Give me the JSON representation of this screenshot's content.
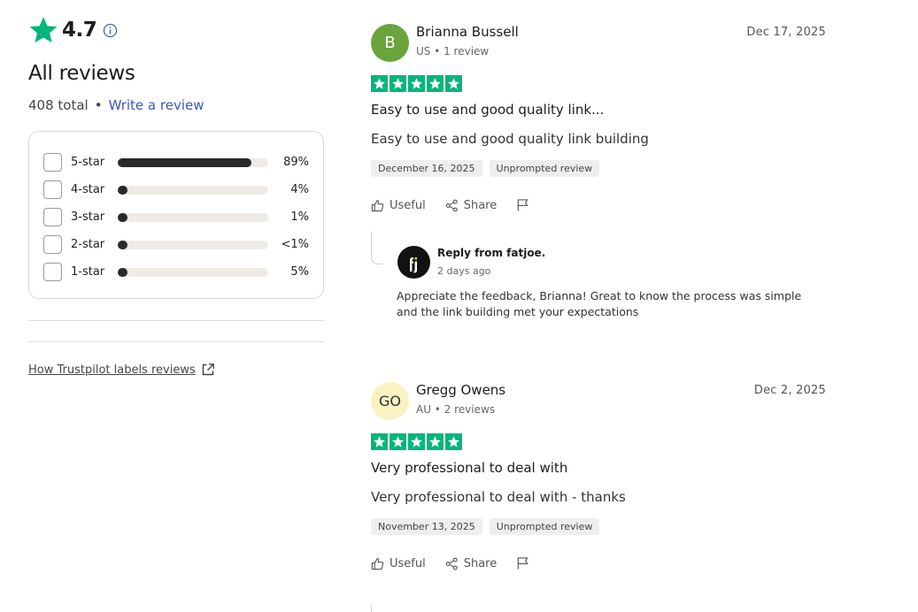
{
  "summary": {
    "rating": "4.7",
    "heading": "All reviews",
    "total": "408 total",
    "separator": "•",
    "write_review": "Write a review",
    "distribution": [
      {
        "label": "5-star",
        "percent_text": "89%",
        "fill": 0.89
      },
      {
        "label": "4-star",
        "percent_text": "4%",
        "fill": 0.04
      },
      {
        "label": "3-star",
        "percent_text": "1%",
        "fill": 0.01
      },
      {
        "label": "2-star",
        "percent_text": "<1%",
        "fill": 0.005
      },
      {
        "label": "1-star",
        "percent_text": "5%",
        "fill": 0.05
      }
    ],
    "labels_link": "How Trustpilot labels reviews"
  },
  "reviews": [
    {
      "avatar": "B",
      "name": "Brianna Bussell",
      "sub": "US • 1 review",
      "date": "Dec 17, 2025",
      "stars": 5,
      "title": "Easy to use and good quality link...",
      "body": "Easy to use and good quality link building",
      "tags": [
        "December 16, 2025",
        "Unprompted review"
      ],
      "useful": "Useful",
      "share": "Share",
      "reply": {
        "from": "Reply from fatjoe.",
        "time": "2 days ago",
        "text": "Appreciate the feedback, Brianna! Great to know the process was simple and the link building met your expectations"
      }
    },
    {
      "avatar": "GO",
      "name": "Gregg Owens",
      "sub": "AU • 2 reviews",
      "date": "Dec 2, 2025",
      "stars": 5,
      "title": "Very professional to deal with",
      "body": "Very professional to deal with - thanks",
      "tags": [
        "November 13, 2025",
        "Unprompted review"
      ],
      "useful": "Useful",
      "share": "Share"
    }
  ],
  "colors": {
    "trust_green": "#00b67a",
    "link_blue": "#3c57bc",
    "avatar_b": "#6aa43c",
    "avatar_go": "#fbf2c4"
  },
  "icons": [
    "star-icon",
    "info-icon",
    "external-link-icon",
    "thumbs-up-icon",
    "share-icon",
    "flag-icon",
    "fatjoe-logo"
  ]
}
